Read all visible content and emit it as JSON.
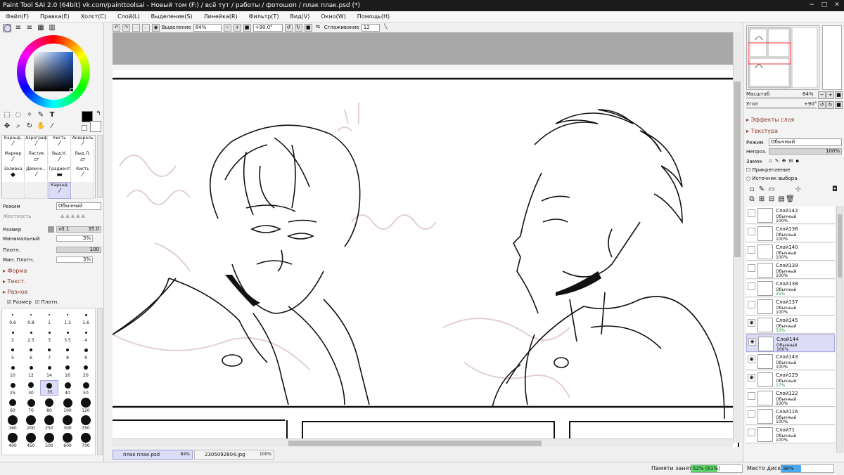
{
  "window": {
    "title": "Paint Tool SAI 2.0 (64bit) vk.com/painttoolsai - Новый том (F:) / всё тут / работы / фотошоп / плак плак.psd (*)",
    "minimize": "−",
    "maximize": "□",
    "close": "✕"
  },
  "menu": [
    "Файл(F)",
    "Правка(E)",
    "Холст(C)",
    "Слой(L)",
    "Выделение(S)",
    "Линейка(R)",
    "Фильтр(T)",
    "Вид(V)",
    "Окно(W)",
    "Помощь(H)"
  ],
  "toolbar": {
    "selection_label": "Выделение",
    "zoom": "84%",
    "minus": "−",
    "plus": "+",
    "rotation": "+90.0°",
    "smoothing_label": "Сглаживание",
    "smoothing_value": "12"
  },
  "colors": {
    "primary": "#000000",
    "secondary": "#ffffff",
    "selection": "#dcdcf6",
    "memory_bar": "#5dd46a",
    "disk_bar": "#4aa8f0"
  },
  "brushes": [
    "Каранд.",
    "Аэрограф",
    "Кисть",
    "Акварель",
    "Маркер",
    "Ластик",
    "Выд.К.",
    "Выд.Л.",
    "Заливка",
    "Двоичн...",
    "Градиент",
    "Кисть",
    "",
    "",
    "Каранд.",
    ""
  ],
  "tool_settings": {
    "mode_label": "Режим",
    "mode_value": "Обычный",
    "hardness_label": "Жесткость",
    "size_label": "Размер",
    "size_mult": "x0.1",
    "size_value": "35.0",
    "min_label": "Минимальный",
    "min_value": "3%",
    "density_label": "Плотн.",
    "density_value": "100",
    "min_density_label": "Мин. Плотн.",
    "min_density_value": "3%",
    "section_shape": "Форма",
    "section_texture": "Текст.",
    "section_misc": "Разное",
    "check_size": "Размер",
    "check_density": "Плотн."
  },
  "brush_sizes": [
    "0.6",
    "0.8",
    "1",
    "1.3",
    "1.6",
    "2",
    "2.5",
    "3",
    "3.5",
    "4",
    "5",
    "6",
    "7",
    "8",
    "9",
    "10",
    "12",
    "14",
    "16",
    "20",
    "25",
    "30",
    "35",
    "40",
    "50",
    "60",
    "70",
    "80",
    "100",
    "120",
    "160",
    "200",
    "250",
    "300",
    "350",
    "400",
    "450",
    "500",
    "600",
    "700"
  ],
  "navigator": {
    "scale_label": "Масштаб",
    "scale_value": "84%",
    "angle_label": "Угол",
    "angle_value": "+90°"
  },
  "layer_panel": {
    "effects": "Эффекты слоя",
    "texture": "Текстура",
    "mode_label": "Режим",
    "mode_value": "Обычный",
    "opacity_label": "Непроз.",
    "opacity_value": "100%",
    "lock_label": "Замок",
    "clip_label": "Прикрепление",
    "source_label": "Источник выбора"
  },
  "layers": [
    {
      "name": "Слой142",
      "mode": "Обычный",
      "opacity": "100%",
      "visible": false,
      "selected": false
    },
    {
      "name": "Слой136",
      "mode": "Обычный",
      "opacity": "100%",
      "visible": false,
      "selected": false
    },
    {
      "name": "Слой140",
      "mode": "Обычный",
      "opacity": "100%",
      "visible": false,
      "selected": false
    },
    {
      "name": "Слой139",
      "mode": "Обычный",
      "opacity": "100%",
      "visible": false,
      "selected": false
    },
    {
      "name": "Слой138",
      "mode": "Обычный",
      "opacity": "25%",
      "visible": false,
      "selected": false
    },
    {
      "name": "Слой137",
      "mode": "Обычный",
      "opacity": "100%",
      "visible": false,
      "selected": false
    },
    {
      "name": "Слой145",
      "mode": "Обычный",
      "opacity": "33%",
      "visible": true,
      "selected": false
    },
    {
      "name": "Слой144",
      "mode": "Обычный",
      "opacity": "100%",
      "visible": true,
      "selected": true
    },
    {
      "name": "Слой143",
      "mode": "Обычный",
      "opacity": "100%",
      "visible": true,
      "selected": false
    },
    {
      "name": "Слой129",
      "mode": "Обычный",
      "opacity": "17%",
      "visible": true,
      "selected": false
    },
    {
      "name": "Слой122",
      "mode": "Обычный",
      "opacity": "100%",
      "visible": false,
      "selected": false
    },
    {
      "name": "Слой116",
      "mode": "Обычный",
      "opacity": "100%",
      "visible": false,
      "selected": false
    },
    {
      "name": "Слой71",
      "mode": "Обычный",
      "opacity": "100%",
      "visible": false,
      "selected": false
    }
  ],
  "documents": [
    {
      "name": "плак плак.psd",
      "zoom": "84%",
      "active": true
    },
    {
      "name": "2305092804.jpg",
      "zoom": "100%",
      "active": false
    }
  ],
  "status": {
    "memory_label": "Памяти занято",
    "memory_value": "52% (61%)",
    "memory_fraction": 0.52,
    "disk_label": "Место диска",
    "disk_value": "38%",
    "disk_fraction": 0.38
  },
  "icons": [
    "color-wheel-icon",
    "pen-icon",
    "eraser-icon",
    "eye-icon",
    "lock-icon",
    "trash-icon",
    "new-layer-icon"
  ]
}
